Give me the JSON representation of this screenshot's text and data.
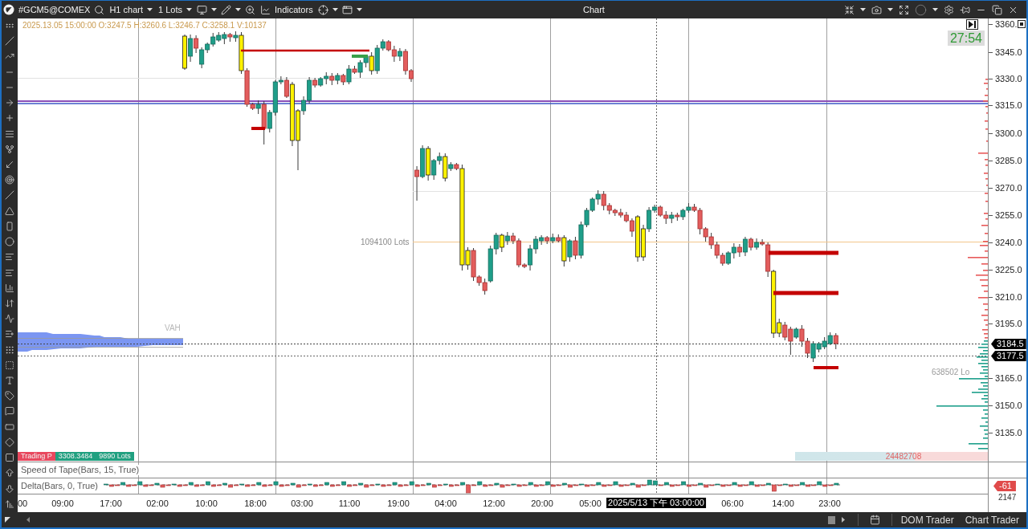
{
  "window": {
    "title": "Chart"
  },
  "toolbar": {
    "symbol": "#GCM5@COMEX",
    "timeframe": "H1 chart",
    "quantity": "1 Lots",
    "indicators": "Indicators"
  },
  "chart": {
    "bar_info": "2025.13.05 15:00:00 O:3247.5 H:3260.6 L:3246.7 C:3258.1 V:10137",
    "timer": "27:54",
    "poc_label": "1094100 Lots",
    "value_area_label": "VAH",
    "profile_label": "638502 Lo",
    "volume_total": "24482708",
    "legend": [
      {
        "text": "Trading P",
        "color": "#e8485e"
      },
      {
        "text": "3308.3484",
        "color": "#20a080"
      },
      {
        "text": "9890 Lots",
        "color": "#20a080"
      }
    ]
  },
  "price_axis": {
    "labels": [
      "3360.",
      "3345.0",
      "3330.0",
      "3315.0",
      "3300.0",
      "3285.0",
      "3270.0",
      "3255.0",
      "3240.0",
      "3225.0",
      "3210.0",
      "3195.0",
      "3165.0",
      "3150.0",
      "3135.0"
    ],
    "tags": [
      "3184.5",
      "3177.5"
    ]
  },
  "speed_of_tape_pane": {
    "title": "Speed of Tape(Bars, 15, True)"
  },
  "delta_pane": {
    "title": "Delta(Bars, 0, True)",
    "tag": "-61",
    "reading": "2147"
  },
  "time_axis": {
    "labels": [
      "00",
      "09:00",
      "17:00",
      "02:00",
      "10:00",
      "18:00",
      "03:00",
      "11:00",
      "19:00",
      "04:00",
      "12:00",
      "20:00",
      "05:00",
      "06:00",
      "14:00",
      "23:00"
    ],
    "crosshair_label": "2025/5/13 下午 03:00:00"
  },
  "status_bar": {
    "buttons": [
      "DOM Trader",
      "Chart Trader"
    ]
  }
}
